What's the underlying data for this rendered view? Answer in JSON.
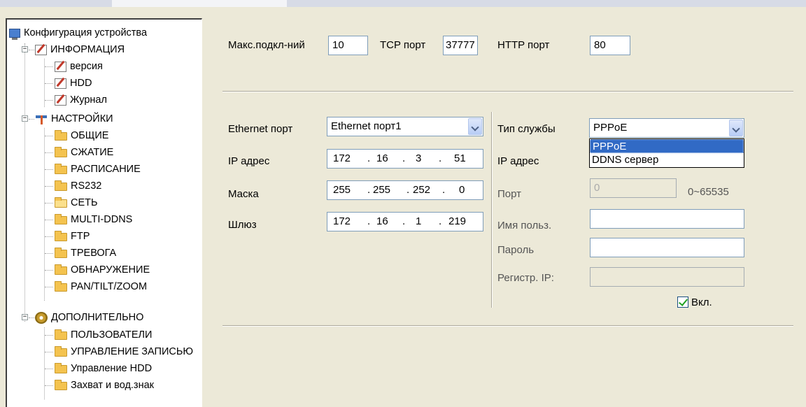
{
  "tree": {
    "root": "Конфигурация устройства",
    "info": {
      "label": "ИНФОРМАЦИЯ",
      "expander": "−",
      "children": [
        "версия",
        "HDD",
        "Журнал"
      ]
    },
    "settings": {
      "label": "НАСТРОЙКИ",
      "expander": "−",
      "children": [
        "ОБЩИЕ",
        "СЖАТИЕ",
        "РАСПИСАНИЕ",
        "RS232",
        "СЕТЬ",
        "MULTI-DDNS",
        "FTP",
        "ТРЕВОГА",
        "ОБНАРУЖЕНИЕ",
        "PAN/TILT/ZOOM"
      ]
    },
    "advanced": {
      "label": "ДОПОЛНИТЕЛЬНО",
      "expander": "−",
      "children": [
        "ПОЛЬЗОВАТЕЛИ",
        "УПРАВЛЕНИЕ ЗАПИСЬЮ",
        "Управление HDD",
        "Захват и вод.знак"
      ]
    }
  },
  "top": {
    "max_conn_label": "Макс.подкл-ний",
    "max_conn_value": "10",
    "tcp_label": "TCP порт",
    "tcp_value": "37777",
    "http_label": "HTTP порт",
    "http_value": "80"
  },
  "eth": {
    "port_label": "Ethernet порт",
    "port_value": "Ethernet порт1",
    "ip_label": "IP адрес",
    "ip": [
      "172",
      "16",
      "3",
      "51"
    ],
    "mask_label": "Маска",
    "mask": [
      "255",
      "255",
      "252",
      "0"
    ],
    "gw_label": "Шлюз",
    "gw": [
      "172",
      "16",
      "1",
      "219"
    ],
    "dot": "."
  },
  "service": {
    "type_label": "Тип службы",
    "type_value": "PPPoE",
    "options": [
      "PPPoE",
      "DDNS сервер"
    ],
    "ip_label": "IP адрес",
    "port_label": "Порт",
    "port_value": "0",
    "port_range": "0~65535",
    "user_label": "Имя польз.",
    "user_value": "",
    "pass_label": "Пароль",
    "pass_value": "",
    "regip_label": "Регистр. IP:",
    "regip_value": "",
    "enable_label": "Вкл.",
    "enabled": true
  }
}
